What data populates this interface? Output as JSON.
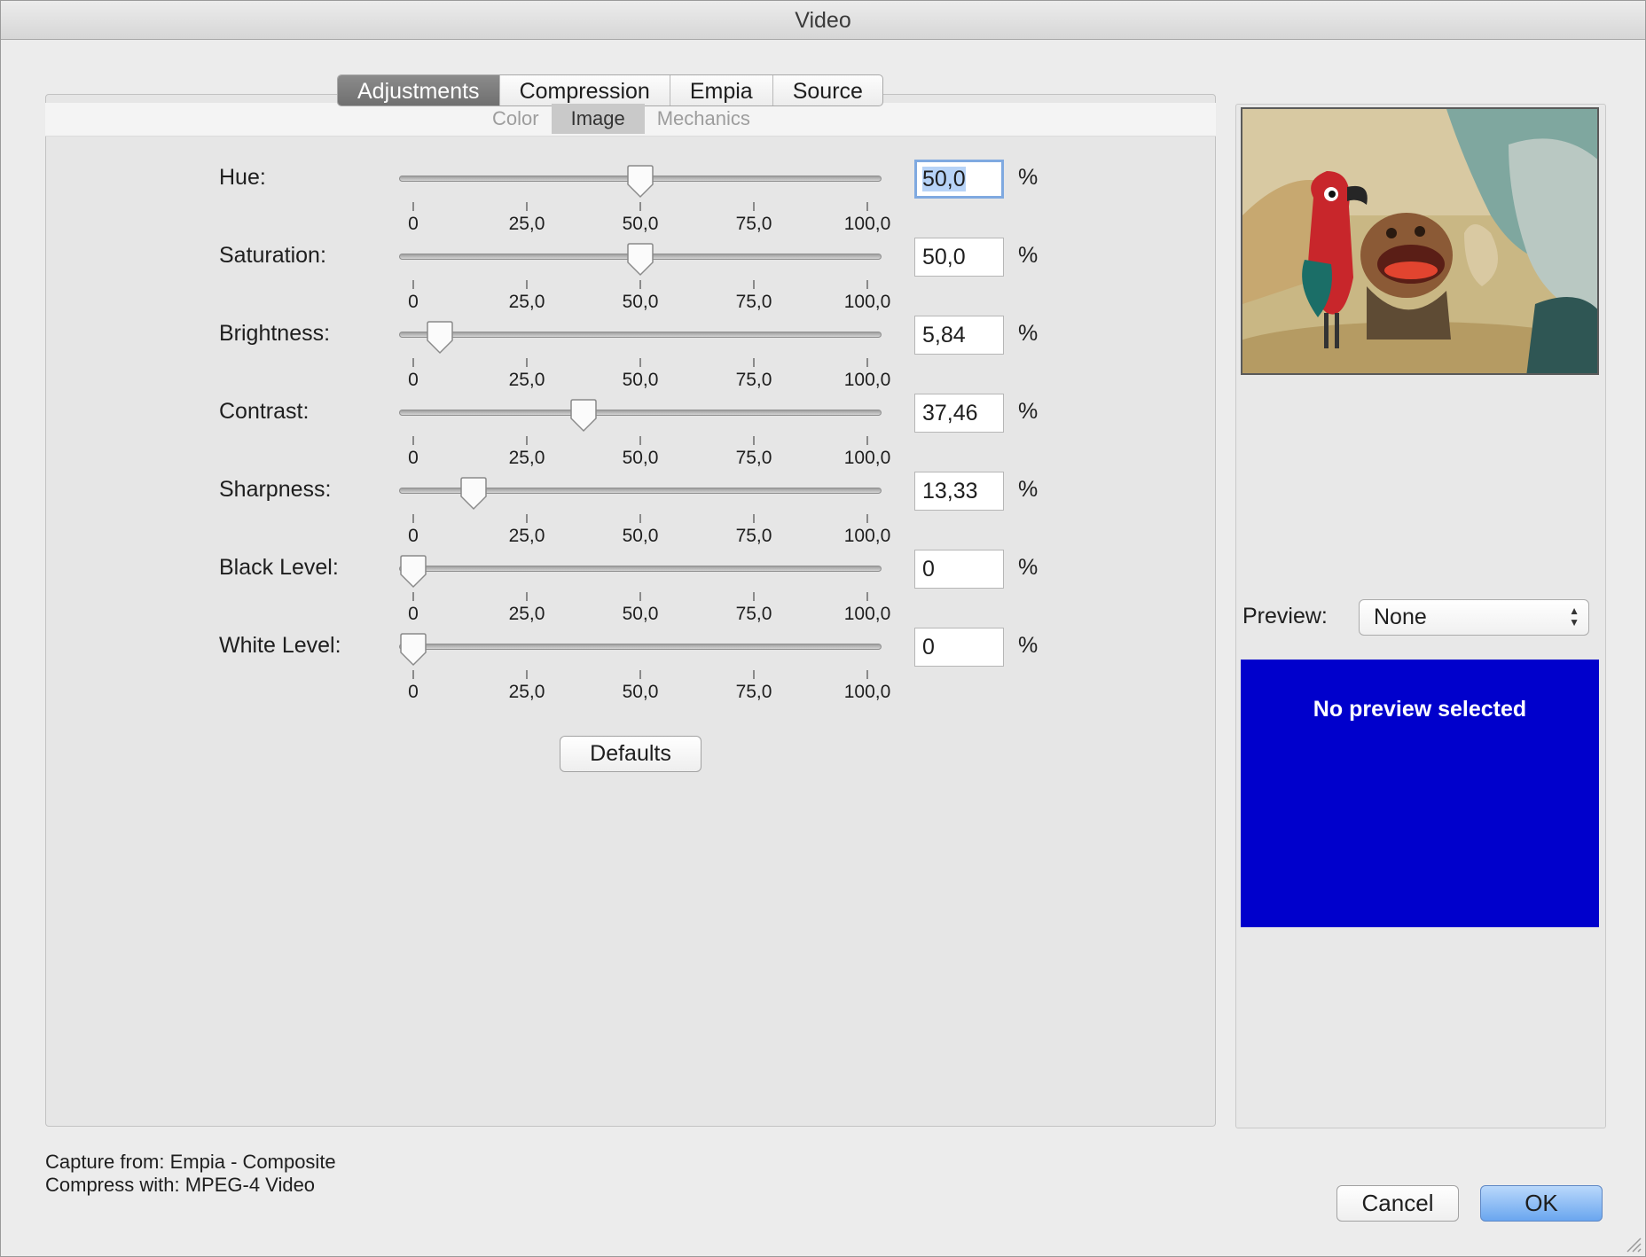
{
  "window": {
    "title": "Video"
  },
  "tabs": [
    {
      "label": "Adjustments",
      "active": true
    },
    {
      "label": "Compression",
      "active": false
    },
    {
      "label": "Empia",
      "active": false
    },
    {
      "label": "Source",
      "active": false
    }
  ],
  "subtabs": [
    {
      "label": "Color",
      "active": false
    },
    {
      "label": "Image",
      "active": true
    },
    {
      "label": "Mechanics",
      "active": false
    }
  ],
  "scale": {
    "min": 0,
    "max": 100,
    "ticks": [
      "0",
      "25,0",
      "50,0",
      "75,0",
      "100,0"
    ]
  },
  "sliders": [
    {
      "name": "hue",
      "label": "Hue:",
      "value": 50.0,
      "display": "50,0",
      "unit": "%",
      "focused": true
    },
    {
      "name": "saturation",
      "label": "Saturation:",
      "value": 50.0,
      "display": "50,0",
      "unit": "%"
    },
    {
      "name": "brightness",
      "label": "Brightness:",
      "value": 5.84,
      "display": "5,84",
      "unit": "%"
    },
    {
      "name": "contrast",
      "label": "Contrast:",
      "value": 37.46,
      "display": "37,46",
      "unit": "%"
    },
    {
      "name": "sharpness",
      "label": "Sharpness:",
      "value": 13.33,
      "display": "13,33",
      "unit": "%"
    },
    {
      "name": "black-level",
      "label": "Black Level:",
      "value": 0,
      "display": "0",
      "unit": "%"
    },
    {
      "name": "white-level",
      "label": "White Level:",
      "value": 0,
      "display": "0",
      "unit": "%"
    }
  ],
  "buttons": {
    "defaults": "Defaults",
    "cancel": "Cancel",
    "ok": "OK"
  },
  "preview": {
    "label": "Preview:",
    "selected": "None",
    "message": "No preview selected",
    "box_color": "#0000cc"
  },
  "status": {
    "capture": "Capture from: Empia - Composite",
    "compress": "Compress with: MPEG-4 Video"
  }
}
